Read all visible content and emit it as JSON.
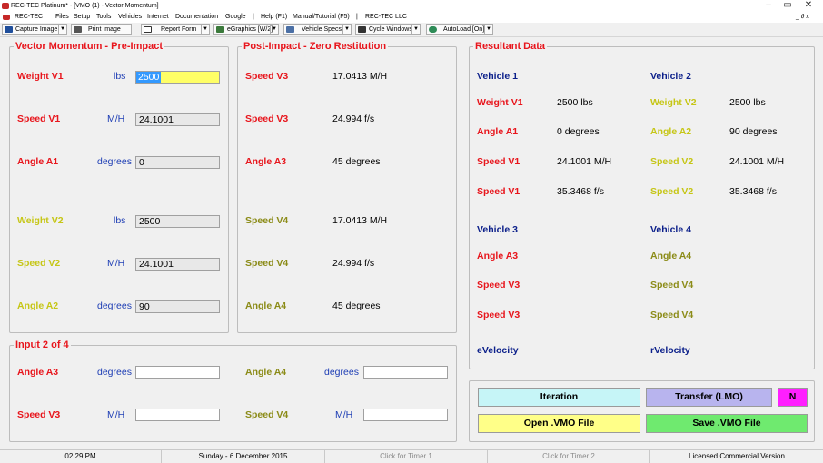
{
  "window": {
    "title": "REC-TEC Platinum* - [VMO (1) - Vector Momentum]",
    "minimize": "–",
    "maximize": "▭",
    "close": "✕",
    "sub_controls": "_ ∂ x"
  },
  "menu": {
    "items": [
      "REC-TEC",
      "Files",
      "Setup",
      "Tools",
      "Vehicles",
      "Internet",
      "Documentation",
      "Google",
      "|",
      "Help (F1)",
      "Manual/Tutorial (F5)",
      "|",
      "REC-TEC LLC"
    ]
  },
  "toolbar": {
    "capture_image": "Capture Image",
    "print_image": "Print Image",
    "report_form": "Report Form",
    "egraphics": "eGraphics [W/2]",
    "vehicle_specs": "Vehicle Specs",
    "cycle_windows": "Cycle Windows",
    "autoload": "AutoLoad [On]",
    "dropdown_glyph": "▼"
  },
  "pre_impact": {
    "title": "Vector Momentum - Pre-Impact",
    "weight_v1": {
      "label": "Weight V1",
      "unit": "lbs",
      "value": "2500"
    },
    "speed_v1": {
      "label": "Speed V1",
      "unit": "M/H",
      "value": "24.1001"
    },
    "angle_a1": {
      "label": "Angle A1",
      "unit": "degrees",
      "value": "0"
    },
    "weight_v2": {
      "label": "Weight V2",
      "unit": "lbs",
      "value": "2500"
    },
    "speed_v2": {
      "label": "Speed V2",
      "unit": "M/H",
      "value": "24.1001"
    },
    "angle_a2": {
      "label": "Angle A2",
      "unit": "degrees",
      "value": "90"
    }
  },
  "post_impact": {
    "title": "Post-Impact - Zero Restitution",
    "speed_v3_mph": {
      "label": "Speed V3",
      "value": "17.0413  M/H"
    },
    "speed_v3_fps": {
      "label": "Speed V3",
      "value": "24.994  f/s"
    },
    "angle_a3": {
      "label": "Angle A3",
      "value": "45  degrees"
    },
    "speed_v4_mph": {
      "label": "Speed V4",
      "value": "17.0413  M/H"
    },
    "speed_v4_fps": {
      "label": "Speed V4",
      "value": "24.994  f/s"
    },
    "angle_a4": {
      "label": "Angle A4",
      "value": "45  degrees"
    }
  },
  "resultant": {
    "title": "Resultant Data",
    "vehicle1": "Vehicle 1",
    "vehicle2": "Vehicle 2",
    "v1_rows": [
      {
        "label": "Weight V1",
        "value": "2500  lbs"
      },
      {
        "label": "Angle A1",
        "value": "0  degrees"
      },
      {
        "label": "Speed V1",
        "value": "24.1001  M/H"
      },
      {
        "label": "Speed V1",
        "value": "35.3468  f/s"
      }
    ],
    "v2_rows": [
      {
        "label": "Weight V2",
        "value": "2500  lbs"
      },
      {
        "label": "Angle A2",
        "value": "90  degrees"
      },
      {
        "label": "Speed V2",
        "value": "24.1001  M/H"
      },
      {
        "label": "Speed V2",
        "value": "35.3468  f/s"
      }
    ],
    "vehicle3": "Vehicle 3",
    "vehicle4": "Vehicle 4",
    "v3_rows": [
      "Angle A3",
      "Speed V3",
      "Speed V3"
    ],
    "v4_rows": [
      "Angle A4",
      "Speed V4",
      "Speed V4"
    ],
    "evelocity": "eVelocity",
    "rvelocity": "rVelocity"
  },
  "input": {
    "title": "Input 2 of 4",
    "angle_a3": {
      "label": "Angle A3",
      "unit": "degrees",
      "value": ""
    },
    "angle_a4": {
      "label": "Angle A4",
      "unit": "degrees",
      "value": ""
    },
    "speed_v3": {
      "label": "Speed V3",
      "unit": "M/H",
      "value": ""
    },
    "speed_v4": {
      "label": "Speed V4",
      "unit": "M/H",
      "value": ""
    }
  },
  "actions": {
    "iteration": "Iteration",
    "transfer": "Transfer (LMO)",
    "n": "N",
    "open": "Open .VMO File",
    "save": "Save .VMO File"
  },
  "status": {
    "time": "02:29 PM",
    "date": "Sunday  -  6 December 2015",
    "timer1": "Click for Timer 1",
    "timer2": "Click for Timer 2",
    "license": "Licensed Commercial Version"
  },
  "colors": {
    "label_red": "#e8151c",
    "label_yellow": "#c6c616",
    "label_olive": "#8b8b17",
    "label_navy": "#0b1f8a",
    "iteration_bg": "#c6f5f7",
    "transfer_bg": "#b8b4ee",
    "n_bg": "#ff1fff",
    "open_bg": "#ffff88",
    "save_bg": "#6fea6f"
  }
}
